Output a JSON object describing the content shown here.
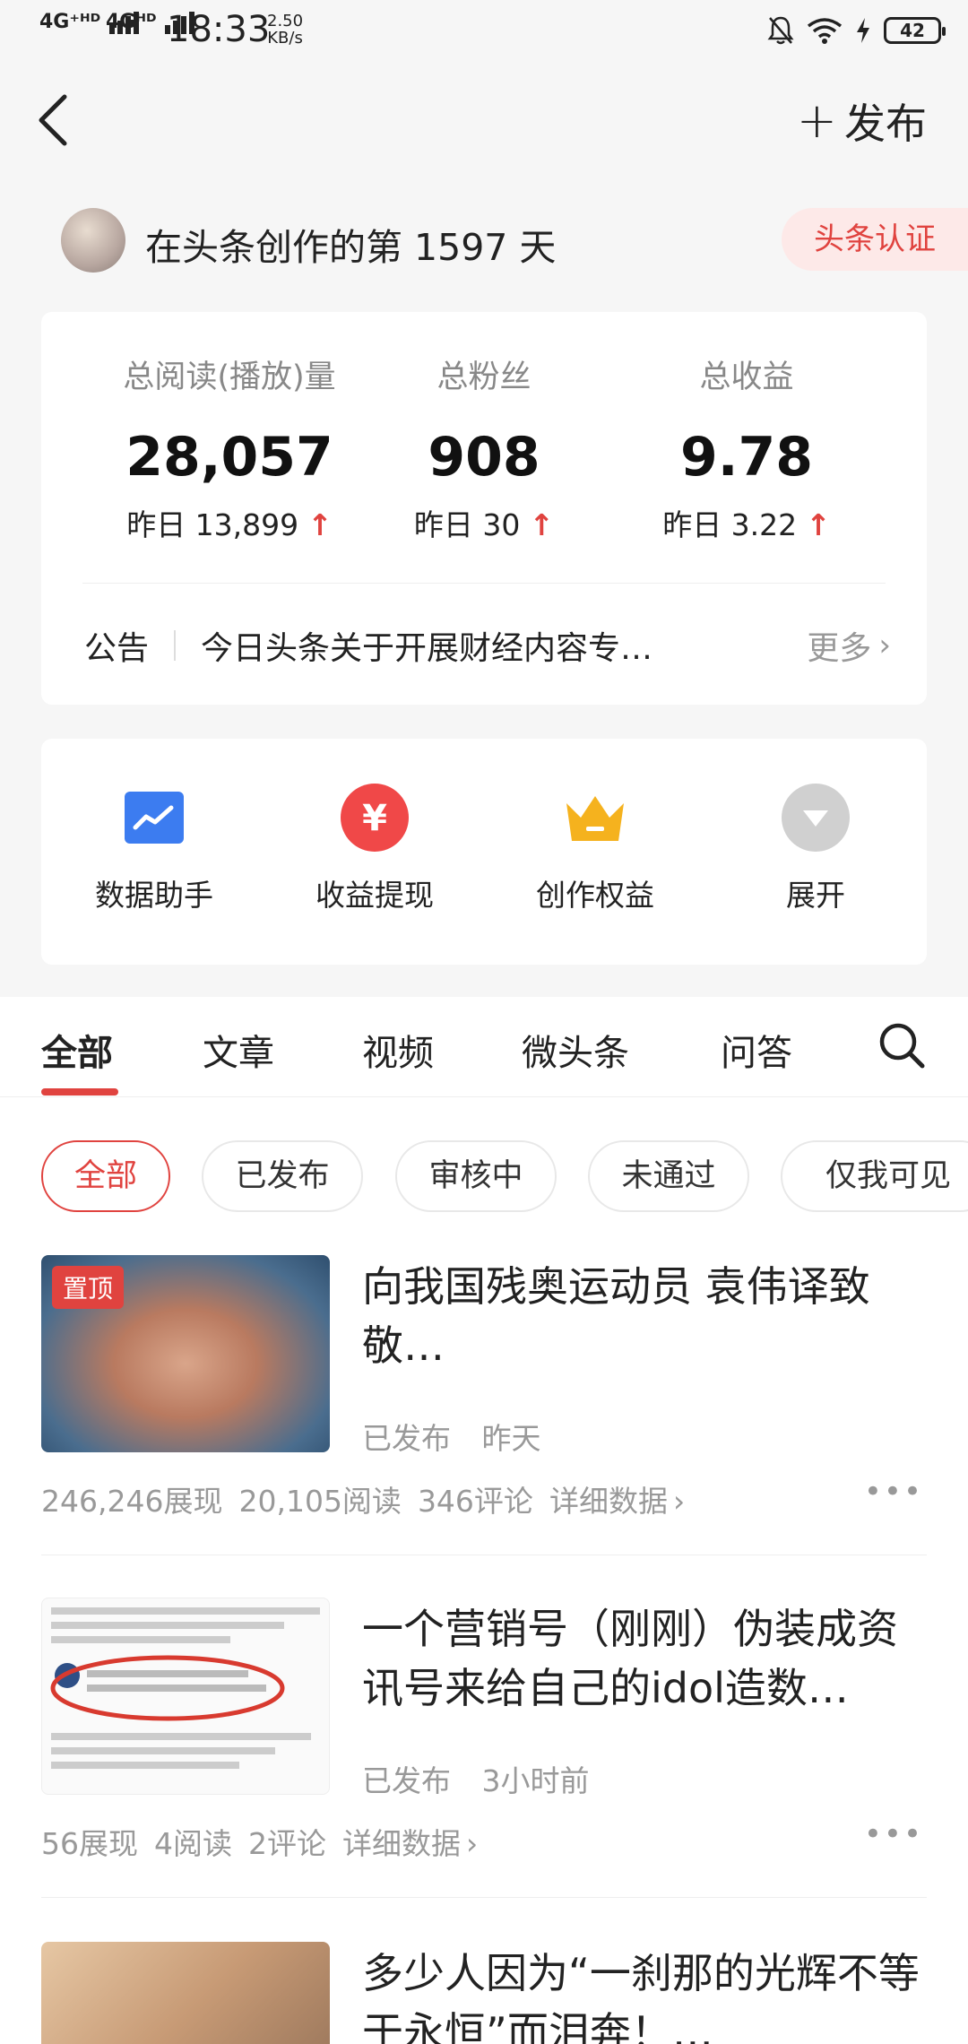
{
  "status_bar": {
    "signal1": "4G⁺ᴴᴰ",
    "signal2": "4Gᴴᴰ",
    "time": "18:33",
    "speed_value": "2.50",
    "speed_unit": "KB/s",
    "battery": "42"
  },
  "header": {
    "publish_label": "发布"
  },
  "profile": {
    "days_text": "在头条创作的第 1597 天",
    "verify_label": "头条认证"
  },
  "stats": [
    {
      "label": "总阅读(播放)量",
      "value": "28,057",
      "yesterday": "昨日 13,899"
    },
    {
      "label": "总粉丝",
      "value": "908",
      "yesterday": "昨日 30"
    },
    {
      "label": "总收益",
      "value": "9.78",
      "yesterday": "昨日 3.22"
    }
  ],
  "notice": {
    "tag": "公告",
    "text": "今日头条关于开展财经内容专…",
    "more": "更多"
  },
  "tools": [
    {
      "label": "数据助手",
      "icon": "chart-icon",
      "color": "#3c7cf0"
    },
    {
      "label": "收益提现",
      "icon": "yuan-icon",
      "color": "#f04848"
    },
    {
      "label": "创作权益",
      "icon": "crown-icon",
      "color": "#f5b21e"
    },
    {
      "label": "展开",
      "icon": "expand-icon",
      "color": "#d0d0d0"
    }
  ],
  "tabs": [
    "全部",
    "文章",
    "视频",
    "微头条",
    "问答"
  ],
  "filters": [
    "全部",
    "已发布",
    "审核中",
    "未通过",
    "仅我可见"
  ],
  "items": [
    {
      "pinned_label": "置顶",
      "title": "向我国残奥运动员 袁伟译致敬…",
      "status": "已发布",
      "time": "昨天",
      "impressions": "246,246展现",
      "reads": "20,105阅读",
      "comments": "346评论",
      "detail": "详细数据"
    },
    {
      "title": "一个营销号（刚刚）伪装成资讯号来给自己的idol造数…",
      "status": "已发布",
      "time": "3小时前",
      "impressions": "56展现",
      "reads": "4阅读",
      "comments": "2评论",
      "detail": "详细数据"
    },
    {
      "title": "多少人因为“一刹那的光辉不等于永恒”而泪奔！…"
    }
  ],
  "colors": {
    "accent": "#e0433f",
    "background": "#f6f6f6"
  }
}
